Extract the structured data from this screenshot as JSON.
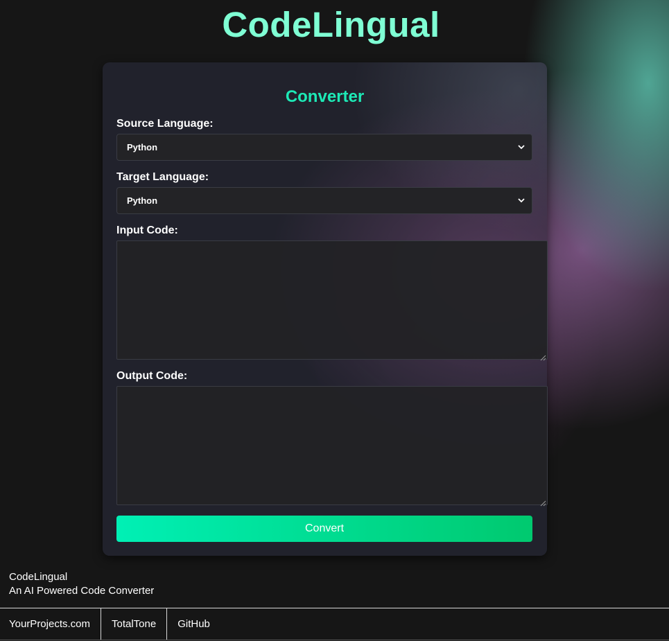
{
  "app": {
    "title": "CodeLingual"
  },
  "converter": {
    "title": "Converter",
    "source_label": "Source Language:",
    "source_value": "Python",
    "target_label": "Target Language:",
    "target_value": "Python",
    "input_label": "Input Code:",
    "input_value": "",
    "output_label": "Output Code:",
    "output_value": "",
    "convert_label": "Convert"
  },
  "footer": {
    "brand_name": "CodeLingual",
    "tagline": "An AI Powered Code Converter",
    "links": [
      {
        "label": "YourProjects.com"
      },
      {
        "label": "TotalTone"
      },
      {
        "label": "GitHub"
      }
    ]
  },
  "colors": {
    "title": "#7fffd4",
    "accent": "#1de9b6",
    "button_start": "#00f0b5",
    "button_end": "#00c96f",
    "background": "#161616"
  },
  "icons": {
    "select_arrow": "chevron-down-icon",
    "textarea_resize": "resize-grip-icon"
  }
}
